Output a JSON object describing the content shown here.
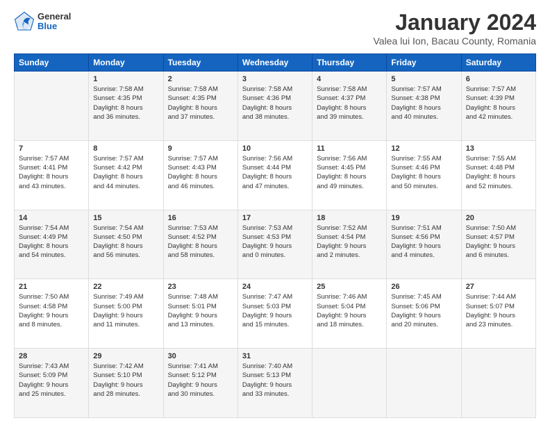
{
  "header": {
    "logo_general": "General",
    "logo_blue": "Blue",
    "month_title": "January 2024",
    "location": "Valea lui Ion, Bacau County, Romania"
  },
  "days_of_week": [
    "Sunday",
    "Monday",
    "Tuesday",
    "Wednesday",
    "Thursday",
    "Friday",
    "Saturday"
  ],
  "weeks": [
    [
      {
        "day": "",
        "info": ""
      },
      {
        "day": "1",
        "info": "Sunrise: 7:58 AM\nSunset: 4:35 PM\nDaylight: 8 hours\nand 36 minutes."
      },
      {
        "day": "2",
        "info": "Sunrise: 7:58 AM\nSunset: 4:35 PM\nDaylight: 8 hours\nand 37 minutes."
      },
      {
        "day": "3",
        "info": "Sunrise: 7:58 AM\nSunset: 4:36 PM\nDaylight: 8 hours\nand 38 minutes."
      },
      {
        "day": "4",
        "info": "Sunrise: 7:58 AM\nSunset: 4:37 PM\nDaylight: 8 hours\nand 39 minutes."
      },
      {
        "day": "5",
        "info": "Sunrise: 7:57 AM\nSunset: 4:38 PM\nDaylight: 8 hours\nand 40 minutes."
      },
      {
        "day": "6",
        "info": "Sunrise: 7:57 AM\nSunset: 4:39 PM\nDaylight: 8 hours\nand 42 minutes."
      }
    ],
    [
      {
        "day": "7",
        "info": "Sunrise: 7:57 AM\nSunset: 4:41 PM\nDaylight: 8 hours\nand 43 minutes."
      },
      {
        "day": "8",
        "info": "Sunrise: 7:57 AM\nSunset: 4:42 PM\nDaylight: 8 hours\nand 44 minutes."
      },
      {
        "day": "9",
        "info": "Sunrise: 7:57 AM\nSunset: 4:43 PM\nDaylight: 8 hours\nand 46 minutes."
      },
      {
        "day": "10",
        "info": "Sunrise: 7:56 AM\nSunset: 4:44 PM\nDaylight: 8 hours\nand 47 minutes."
      },
      {
        "day": "11",
        "info": "Sunrise: 7:56 AM\nSunset: 4:45 PM\nDaylight: 8 hours\nand 49 minutes."
      },
      {
        "day": "12",
        "info": "Sunrise: 7:55 AM\nSunset: 4:46 PM\nDaylight: 8 hours\nand 50 minutes."
      },
      {
        "day": "13",
        "info": "Sunrise: 7:55 AM\nSunset: 4:48 PM\nDaylight: 8 hours\nand 52 minutes."
      }
    ],
    [
      {
        "day": "14",
        "info": "Sunrise: 7:54 AM\nSunset: 4:49 PM\nDaylight: 8 hours\nand 54 minutes."
      },
      {
        "day": "15",
        "info": "Sunrise: 7:54 AM\nSunset: 4:50 PM\nDaylight: 8 hours\nand 56 minutes."
      },
      {
        "day": "16",
        "info": "Sunrise: 7:53 AM\nSunset: 4:52 PM\nDaylight: 8 hours\nand 58 minutes."
      },
      {
        "day": "17",
        "info": "Sunrise: 7:53 AM\nSunset: 4:53 PM\nDaylight: 9 hours\nand 0 minutes."
      },
      {
        "day": "18",
        "info": "Sunrise: 7:52 AM\nSunset: 4:54 PM\nDaylight: 9 hours\nand 2 minutes."
      },
      {
        "day": "19",
        "info": "Sunrise: 7:51 AM\nSunset: 4:56 PM\nDaylight: 9 hours\nand 4 minutes."
      },
      {
        "day": "20",
        "info": "Sunrise: 7:50 AM\nSunset: 4:57 PM\nDaylight: 9 hours\nand 6 minutes."
      }
    ],
    [
      {
        "day": "21",
        "info": "Sunrise: 7:50 AM\nSunset: 4:58 PM\nDaylight: 9 hours\nand 8 minutes."
      },
      {
        "day": "22",
        "info": "Sunrise: 7:49 AM\nSunset: 5:00 PM\nDaylight: 9 hours\nand 11 minutes."
      },
      {
        "day": "23",
        "info": "Sunrise: 7:48 AM\nSunset: 5:01 PM\nDaylight: 9 hours\nand 13 minutes."
      },
      {
        "day": "24",
        "info": "Sunrise: 7:47 AM\nSunset: 5:03 PM\nDaylight: 9 hours\nand 15 minutes."
      },
      {
        "day": "25",
        "info": "Sunrise: 7:46 AM\nSunset: 5:04 PM\nDaylight: 9 hours\nand 18 minutes."
      },
      {
        "day": "26",
        "info": "Sunrise: 7:45 AM\nSunset: 5:06 PM\nDaylight: 9 hours\nand 20 minutes."
      },
      {
        "day": "27",
        "info": "Sunrise: 7:44 AM\nSunset: 5:07 PM\nDaylight: 9 hours\nand 23 minutes."
      }
    ],
    [
      {
        "day": "28",
        "info": "Sunrise: 7:43 AM\nSunset: 5:09 PM\nDaylight: 9 hours\nand 25 minutes."
      },
      {
        "day": "29",
        "info": "Sunrise: 7:42 AM\nSunset: 5:10 PM\nDaylight: 9 hours\nand 28 minutes."
      },
      {
        "day": "30",
        "info": "Sunrise: 7:41 AM\nSunset: 5:12 PM\nDaylight: 9 hours\nand 30 minutes."
      },
      {
        "day": "31",
        "info": "Sunrise: 7:40 AM\nSunset: 5:13 PM\nDaylight: 9 hours\nand 33 minutes."
      },
      {
        "day": "",
        "info": ""
      },
      {
        "day": "",
        "info": ""
      },
      {
        "day": "",
        "info": ""
      }
    ]
  ]
}
